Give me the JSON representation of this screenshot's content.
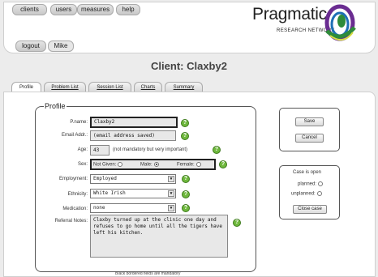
{
  "nav": {
    "clients": "clients",
    "users": "users",
    "measures": "measures",
    "help": "help",
    "logout": "logout",
    "user": "Mike"
  },
  "logo": {
    "title": "Pragmatic",
    "subtitle": "RESEARCH NETWORK",
    "colors": [
      "#6a2c91",
      "#2e8b3a",
      "#1f6fb5",
      "#d8e044"
    ]
  },
  "page": {
    "title": "Client: Claxby2"
  },
  "tabs": [
    {
      "label": "Profile",
      "active": true
    },
    {
      "label": "Problem List"
    },
    {
      "label": "Session List"
    },
    {
      "label": "Charts"
    },
    {
      "label": "Summary"
    }
  ],
  "form": {
    "legend": "Profile",
    "pname_label": "P.name:",
    "pname_value": "Claxby2",
    "email_label": "Email Addr.:",
    "email_value": "(email address saved)",
    "age_label": "Age:",
    "age_value": "43",
    "age_note": "(not mandatory but very important)",
    "sex_label": "Sex:",
    "sex_options": [
      "Not Given:",
      "Male:",
      "Female:"
    ],
    "sex_selected": "Male:",
    "employment_label": "Employment:",
    "employment_value": "Employed",
    "ethnicity_label": "Ethnicity:",
    "ethnicity_value": "White Irish",
    "medication_label": "Medication:",
    "medication_value": "none",
    "referral_label": "Referral Notes:",
    "referral_value": "Claxby turned up at the clinic one day and refuses to go home until all the tigers have left his kitchen.",
    "mandatory_note": "Black bordered fields are mandatory",
    "help_symbol": "?"
  },
  "actions": {
    "save": "Save",
    "cancel": "Cancel"
  },
  "case": {
    "status": "Case is open",
    "planned": "planned:",
    "unplanned": "unplanned:",
    "close": "Close case"
  }
}
